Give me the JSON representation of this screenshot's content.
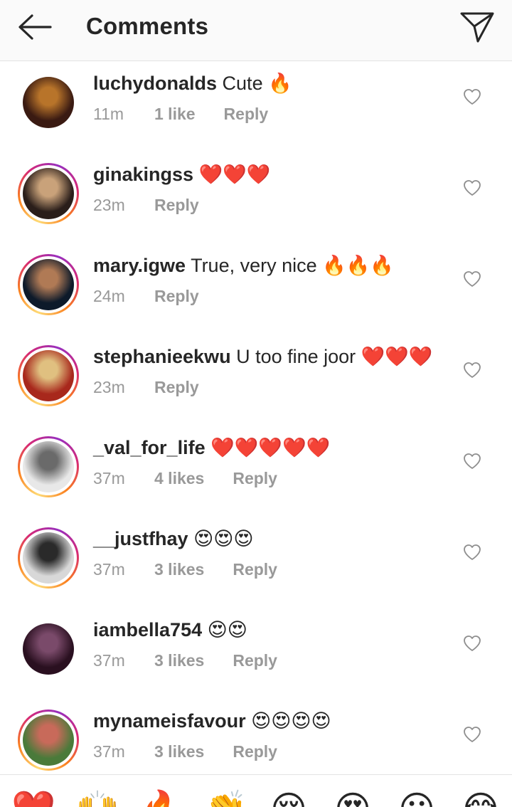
{
  "header": {
    "title": "Comments",
    "back_icon": "arrow-left-icon",
    "send_icon": "paper-plane-icon"
  },
  "colors": {
    "text": "#262626",
    "meta": "#999999",
    "header_bg": "#fafafa",
    "heart_red": "#e0245e"
  },
  "comments": [
    {
      "username": "luchydonalds",
      "text": "Cute 🔥",
      "time": "11m",
      "likes": "1 like",
      "reply": "Reply",
      "story_ring": false,
      "avatar_colors": [
        "#3a1a12",
        "#b8742a"
      ]
    },
    {
      "username": "ginakingss",
      "text": "❤️❤️❤️",
      "time": "23m",
      "likes": "",
      "reply": "Reply",
      "story_ring": true,
      "avatar_colors": [
        "#2a1e1a",
        "#c9a27a"
      ]
    },
    {
      "username": "mary.igwe",
      "text": "True, very nice 🔥🔥🔥",
      "time": "24m",
      "likes": "",
      "reply": "Reply",
      "story_ring": true,
      "avatar_colors": [
        "#0d1a2a",
        "#b07a55"
      ]
    },
    {
      "username": "stephanieekwu",
      "text": "U too fine joor ❤️❤️❤️",
      "time": "23m",
      "likes": "",
      "reply": "Reply",
      "story_ring": true,
      "avatar_colors": [
        "#a8281c",
        "#e0c080"
      ]
    },
    {
      "username": "_val_for_life",
      "text": "❤️❤️❤️❤️❤️",
      "time": "37m",
      "likes": "4 likes",
      "reply": "Reply",
      "story_ring": true,
      "avatar_colors": [
        "#e8e8e8",
        "#6a6a6a"
      ]
    },
    {
      "username": "__justfhay",
      "text": "😍😍😍",
      "time": "37m",
      "likes": "3 likes",
      "reply": "Reply",
      "story_ring": true,
      "avatar_colors": [
        "#d8d8d8",
        "#2a2a2a"
      ]
    },
    {
      "username": "iambella754",
      "text": "😍😍",
      "time": "37m",
      "likes": "3 likes",
      "reply": "Reply",
      "story_ring": false,
      "avatar_colors": [
        "#2a1020",
        "#7a4a6a"
      ]
    },
    {
      "username": "mynameisfavour",
      "text": "😍😍😍😍",
      "time": "37m",
      "likes": "3 likes",
      "reply": "Reply",
      "story_ring": true,
      "avatar_colors": [
        "#4a7a3a",
        "#c86a5a"
      ]
    }
  ],
  "comment_like_icon": "heart-outline-icon",
  "reactions": [
    "❤️",
    "🙌",
    "🔥",
    "👏",
    "😢",
    "😍",
    "😮",
    "😂"
  ]
}
